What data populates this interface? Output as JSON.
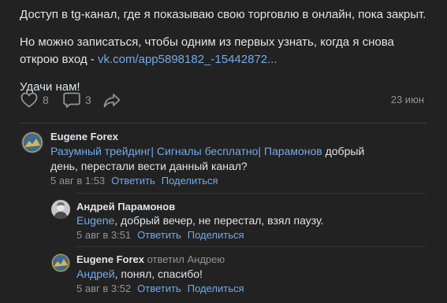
{
  "post": {
    "para1": "Доступ в tg-канал, где я показываю свою торговлю в онлайн, пока закрыт.",
    "para2_text": "Но можно записаться, чтобы одним из первых узнать, когда я снова открою вход - ",
    "para2_link": "vk.com/app5898182_-15442872...",
    "para3": "Удачи нам!",
    "likes": "8",
    "comments": "3",
    "date": "23 июн"
  },
  "comments": [
    {
      "author": "Eugene Forex",
      "reply_to": "",
      "mention": "Разумный трейдинг| Сигналы бесплатно| Парамонов",
      "text": " добрый день, перестали вести данный канал?",
      "time": "5 авг в 1:53",
      "reply_label": "Ответить",
      "share_label": "Поделиться"
    },
    {
      "author": "Андрей Парамонов",
      "reply_to": "",
      "mention": "Eugene",
      "text": ", добрый вечер, не перестал, взял паузу.",
      "time": "5 авг в 3:51",
      "reply_label": "Ответить",
      "share_label": "Поделиться"
    },
    {
      "author": "Eugene Forex",
      "reply_to": "ответил Андрею",
      "mention": "Андрей",
      "text": ", понял, спасибо!",
      "time": "5 авг в 3:52",
      "reply_label": "Ответить",
      "share_label": "Поделиться"
    }
  ],
  "colors": {
    "background": "#222222",
    "text": "#e1e3e6",
    "secondary": "#939393",
    "link": "#71aaeb",
    "divider": "#363738"
  },
  "icons": [
    "heart-icon",
    "comment-icon",
    "share-icon"
  ]
}
